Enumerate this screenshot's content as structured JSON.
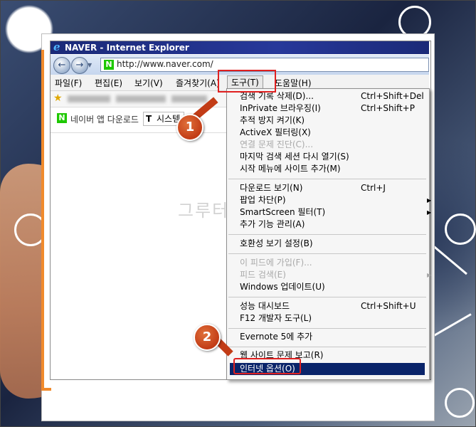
{
  "window": {
    "title": "NAVER - Internet Explorer"
  },
  "address": {
    "url": "http://www.naver.com/",
    "site_badge": "N"
  },
  "nav": {
    "back_glyph": "←",
    "forward_glyph": "→"
  },
  "menubar": {
    "items": [
      "파일(F)",
      "편집(E)",
      "보기(V)",
      "즐겨찾기(A)",
      "도구(T)",
      "도움말(H)"
    ]
  },
  "content": {
    "app_download_label": "네이버 앱 다운로드",
    "toolbar_box_prefix": "T",
    "toolbar_box_text": "시스템"
  },
  "tools_menu": {
    "items": [
      {
        "label": "검색 기록 삭제(D)...",
        "shortcut": "Ctrl+Shift+Del"
      },
      {
        "label": "InPrivate 브라우징(I)",
        "shortcut": "Ctrl+Shift+P"
      },
      {
        "label": "추적 방지 켜기(K)",
        "shortcut": ""
      },
      {
        "label": "ActiveX 필터링(X)",
        "shortcut": ""
      },
      {
        "label": "연결 문제 진단(C)...",
        "shortcut": ""
      },
      {
        "label": "마지막 검색 세션 다시 열기(S)",
        "shortcut": ""
      },
      {
        "label": "시작 메뉴에 사이트 추가(M)",
        "shortcut": ""
      },
      {
        "label": "다운로드 보기(N)",
        "shortcut": "Ctrl+J"
      },
      {
        "label": "팝업 차단(P)",
        "shortcut": ""
      },
      {
        "label": "SmartScreen 필터(T)",
        "shortcut": ""
      },
      {
        "label": "추가 기능 관리(A)",
        "shortcut": ""
      },
      {
        "label": "호환성 보기 설정(B)",
        "shortcut": ""
      },
      {
        "label": "이 피드에 가입(F)...",
        "shortcut": ""
      },
      {
        "label": "피드 검색(E)",
        "shortcut": ""
      },
      {
        "label": "Windows 업데이트(U)",
        "shortcut": ""
      },
      {
        "label": "성능 대시보드",
        "shortcut": "Ctrl+Shift+U"
      },
      {
        "label": "F12 개발자 도구(L)",
        "shortcut": ""
      },
      {
        "label": "Evernote 5에 추가",
        "shortcut": ""
      },
      {
        "label": "웹 사이트 문제 보고(R)",
        "shortcut": ""
      },
      {
        "label": "인터넷 옵션(O)",
        "shortcut": ""
      }
    ]
  },
  "markers": {
    "step1": "1",
    "step2": "2"
  },
  "watermark": "그루터",
  "colors": {
    "menu_highlight": "#0a246a",
    "callout": "#e02020",
    "titlebar": "#1b2a78",
    "accent_orange": "#f08a2c"
  }
}
